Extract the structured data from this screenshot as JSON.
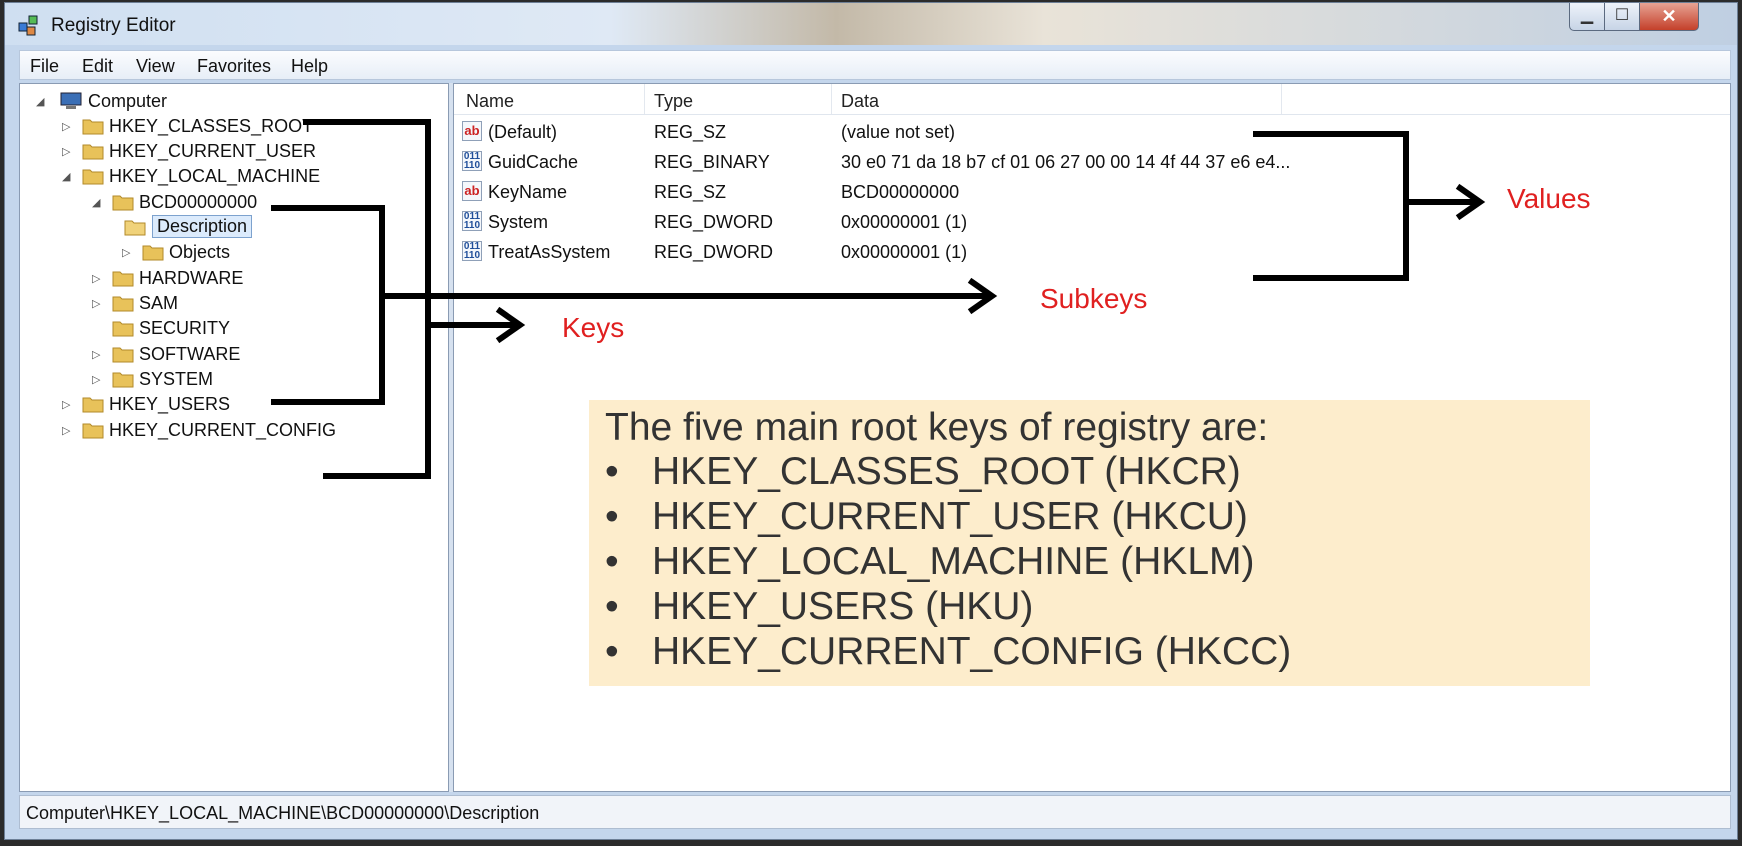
{
  "window": {
    "title": "Registry Editor",
    "controls": {
      "minimize": "▁",
      "maximize": "☐",
      "close": "✕"
    }
  },
  "menu": [
    "File",
    "Edit",
    "View",
    "Favorites",
    "Help"
  ],
  "tree": {
    "computer": "Computer",
    "hkcr": "HKEY_CLASSES_ROOT",
    "hkcu": "HKEY_CURRENT_USER",
    "hklm": "HKEY_LOCAL_MACHINE",
    "bcd": "BCD00000000",
    "description": "Description",
    "objects": "Objects",
    "hardware": "HARDWARE",
    "sam": "SAM",
    "security": "SECURITY",
    "software": "SOFTWARE",
    "system": "SYSTEM",
    "hku": "HKEY_USERS",
    "hkcc": "HKEY_CURRENT_CONFIG"
  },
  "list": {
    "headers": {
      "name": "Name",
      "type": "Type",
      "data": "Data"
    },
    "rows": [
      {
        "icon": "string-value-icon",
        "name": "(Default)",
        "type": "REG_SZ",
        "data": "(value not set)"
      },
      {
        "icon": "binary-value-icon",
        "name": "GuidCache",
        "type": "REG_BINARY",
        "data": "30 e0 71 da 18 b7 cf 01 06 27 00 00 14 4f 44 37 e6 e4..."
      },
      {
        "icon": "string-value-icon",
        "name": "KeyName",
        "type": "REG_SZ",
        "data": "BCD00000000"
      },
      {
        "icon": "binary-value-icon",
        "name": "System",
        "type": "REG_DWORD",
        "data": "0x00000001 (1)"
      },
      {
        "icon": "binary-value-icon",
        "name": "TreatAsSystem",
        "type": "REG_DWORD",
        "data": "0x00000001 (1)"
      }
    ]
  },
  "status": {
    "path": "Computer\\HKEY_LOCAL_MACHINE\\BCD00000000\\Description"
  },
  "annotations": {
    "keys": "Keys",
    "subkeys": "Subkeys",
    "values": "Values"
  },
  "callout": {
    "title": "The five main root keys of registry are:",
    "bullet": "•",
    "items": [
      "HKEY_CLASSES_ROOT (HKCR)",
      "HKEY_CURRENT_USER (HKCU)",
      "HKEY_LOCAL_MACHINE (HKLM)",
      "HKEY_USERS (HKU)",
      "HKEY_CURRENT_CONFIG (HKCC)"
    ]
  },
  "colors": {
    "annotation_text": "#e02020",
    "callout_bg": "#fdedcc",
    "arrow": "#000000"
  }
}
